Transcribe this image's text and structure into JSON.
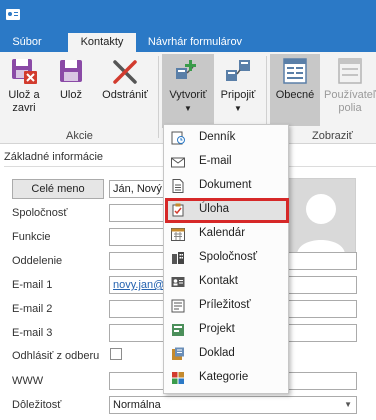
{
  "tabs": [
    {
      "label": "Súbor",
      "active": false
    },
    {
      "label": "Kontakty",
      "active": true
    },
    {
      "label": "Návrhár formulárov",
      "active": false
    }
  ],
  "ribbon": {
    "groups": [
      {
        "label": "Akcie"
      },
      {
        "label": "Zobraziť"
      }
    ],
    "buttons": [
      {
        "label": "Ulož a zavri",
        "icon": "save-close-icon"
      },
      {
        "label": "Ulož",
        "icon": "save-icon"
      },
      {
        "label": "Odstrániť",
        "icon": "delete-icon"
      },
      {
        "label": "Vytvoriť",
        "icon": "create-icon",
        "dropdown": true
      },
      {
        "label": "Pripojiť",
        "icon": "attach-icon",
        "dropdown": true
      },
      {
        "label": "Obecné",
        "icon": "general-view-icon",
        "pressed": true
      },
      {
        "label": "Používateľské polia",
        "icon": "user-fields-icon",
        "disabled": true
      }
    ]
  },
  "form": {
    "section_title": "Základné informácie",
    "fullname_button": "Celé meno",
    "fullname_value": "Ján, Nový",
    "labels": [
      "Spoločnosť",
      "Funkcie",
      "Oddelenie",
      "E-mail 1",
      "E-mail 2",
      "E-mail 3",
      "Odhlásiť z odberu",
      "WWW",
      "Dôležitosť"
    ],
    "email1_value": "novy.jan@",
    "importance_value": "Normálna"
  },
  "menu": {
    "items": [
      {
        "label": "Denník",
        "icon": "journal-icon"
      },
      {
        "label": "E-mail",
        "icon": "email-icon"
      },
      {
        "label": "Dokument",
        "icon": "document-icon"
      },
      {
        "label": "Úloha",
        "icon": "task-icon",
        "selected": true
      },
      {
        "label": "Kalendár",
        "icon": "calendar-icon"
      },
      {
        "label": "Spoločnosť",
        "icon": "company-icon"
      },
      {
        "label": "Kontakt",
        "icon": "contact-icon"
      },
      {
        "label": "Príležitosť",
        "icon": "opportunity-icon"
      },
      {
        "label": "Projekt",
        "icon": "project-icon"
      },
      {
        "label": "Doklad",
        "icon": "voucher-icon"
      },
      {
        "label": "Kategorie",
        "icon": "categories-icon"
      }
    ]
  },
  "colors": {
    "titlebar": "#2b79c6",
    "ribbon": "#f3f3f3",
    "highlight_border": "#d62828"
  }
}
